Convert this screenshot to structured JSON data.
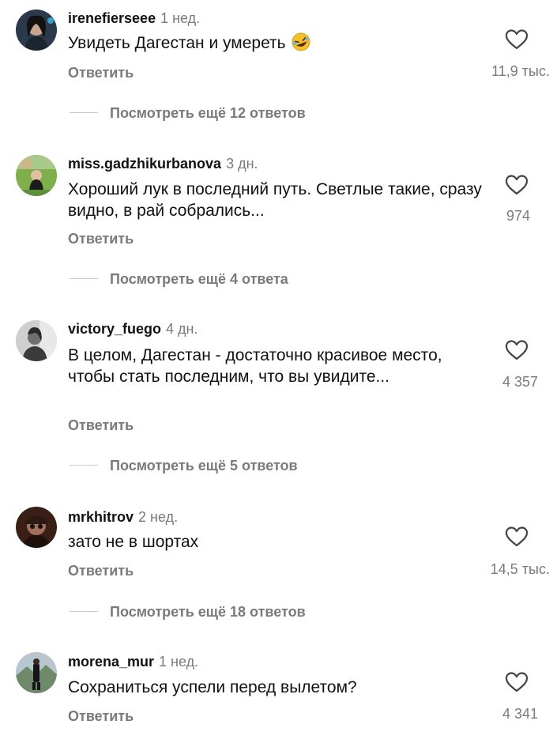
{
  "comments": [
    {
      "username": "irenefierseee",
      "time": "1 нед.",
      "text": "Увидеть Дагестан и умереть",
      "emoji": "rofl-emoji",
      "reply": "Ответить",
      "likes": "11,9 тыс.",
      "more": "Посмотреть ещё 12 ответов"
    },
    {
      "username": "miss.gadzhikurbanova",
      "time": "3 дн.",
      "text": "Хороший лук в последний путь. Светлые такие, сразу видно, в рай собрались...",
      "reply": "Ответить",
      "likes": "974",
      "more": "Посмотреть ещё 4 ответа"
    },
    {
      "username": "victory_fuego",
      "time": "4 дн.",
      "text": "В целом, Дагестан - достаточно красивое место, чтобы стать последним, что вы увидите...",
      "reply": "Ответить",
      "likes": "4 357",
      "more": "Посмотреть ещё 5 ответов"
    },
    {
      "username": "mrkhitrov",
      "time": "2 нед.",
      "text": "зато не в шортах",
      "reply": "Ответить",
      "likes": "14,5 тыс.",
      "more": "Посмотреть ещё 18 ответов"
    },
    {
      "username": "morena_mur",
      "time": "1 нед.",
      "text": "Сохраниться успели перед вылетом?",
      "reply": "Ответить",
      "likes": "4 341"
    }
  ],
  "icons": {
    "like": "heart-outline-icon"
  },
  "colors": {
    "text": "#111111",
    "secondary": "#7a7a7a",
    "divider": "#c8c8c8"
  }
}
